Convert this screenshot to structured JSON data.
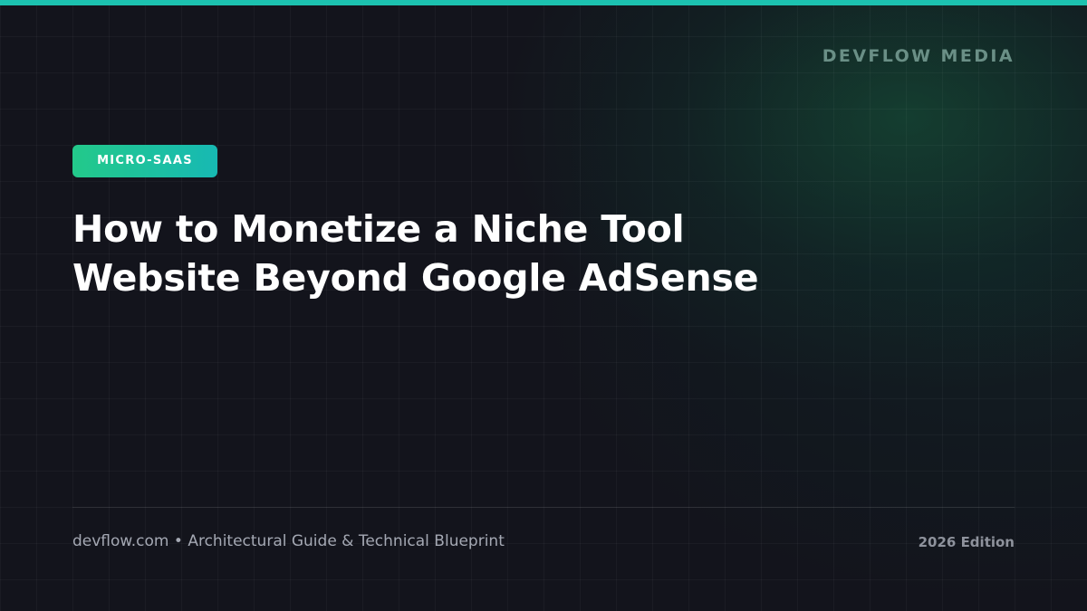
{
  "brand": {
    "name": "DEVFLOW MEDIA"
  },
  "tag": {
    "label": "MICRO-SAAS"
  },
  "title": {
    "line1": "How to Monetize a Niche Tool",
    "line2": "Website Beyond Google AdSense"
  },
  "footer": {
    "site": "devflow.com",
    "separator": "•",
    "subtitle": "Architectural Guide & Technical Blueprint",
    "edition": "2026 Edition"
  },
  "colors": {
    "accent_bar": "#1cc2b0",
    "tag_gradient_start": "#23c98a",
    "tag_gradient_end": "#17b9b3",
    "background": "#13141c",
    "glow": "#165c3e",
    "title_text": "#ffffff",
    "brand_text": "#6a8f86",
    "footer_text": "#a4a8b3"
  }
}
